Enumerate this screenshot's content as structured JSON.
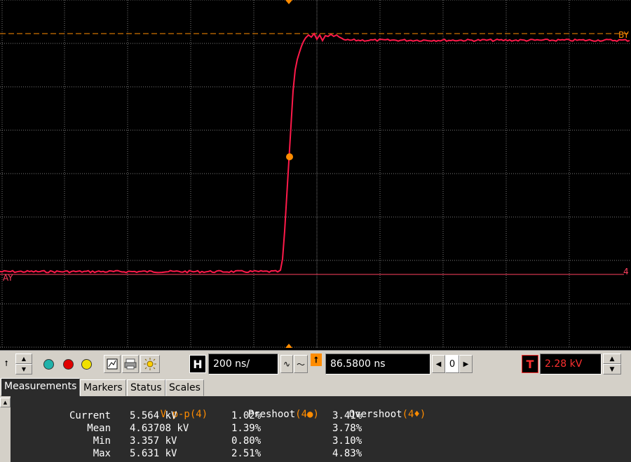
{
  "scope": {
    "channel_label_a": "AY",
    "channel_label_b": "BY",
    "channel_number": "4",
    "colors": {
      "trace": "#ff1a4a",
      "grid": "#7a7a7a",
      "marker": "#ff8c00",
      "ref_line": "#ff4060"
    }
  },
  "toolbar": {
    "h_label": "H",
    "timebase": "200 ns/",
    "delay": "86.5800 ns",
    "nav_left": "◀",
    "nav_value": "0",
    "nav_right": "▶",
    "t_label": "T",
    "trigger_level": "2.28 kV",
    "t_up": "▲",
    "t_down": "▼",
    "arrow_mark": "⭡",
    "small_up": "▲",
    "small_down": "▼",
    "trigger_marker": "⭡",
    "wave_ac": "∿",
    "wave_dc": "〜"
  },
  "tabs": [
    "Measurements",
    "Markers",
    "Status",
    "Scales"
  ],
  "measurements": {
    "headers": {
      "vpp": "V p-p",
      "vpp_ch": "(4)",
      "preshoot": "Preshoot",
      "preshoot_ch": "(4●)",
      "overshoot": "Overshoot",
      "overshoot_ch": "(4♦)"
    },
    "rows": [
      {
        "label": "Current",
        "vpp": "5.564 kV",
        "preshoot": "1.02%",
        "overshoot": "3.41%"
      },
      {
        "label": "Mean",
        "vpp": "4.63708 kV",
        "preshoot": "1.39%",
        "overshoot": "3.78%"
      },
      {
        "label": "Min",
        "vpp": "3.357 kV",
        "preshoot": "0.80%",
        "overshoot": "3.10%"
      },
      {
        "label": "Max",
        "vpp": "5.631 kV",
        "preshoot": "2.51%",
        "overshoot": "4.83%"
      }
    ]
  }
}
